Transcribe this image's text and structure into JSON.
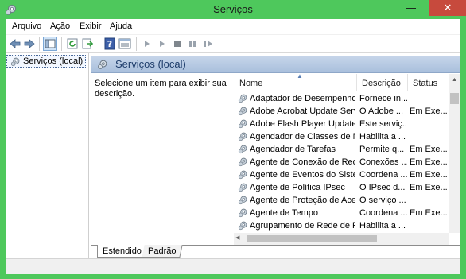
{
  "window": {
    "title": "Serviços",
    "close_glyph": "✕",
    "min_glyph": "—",
    "max_glyph": "☐"
  },
  "menu": {
    "items": [
      "Arquivo",
      "Ação",
      "Exibir",
      "Ajuda"
    ]
  },
  "toolbar": {
    "icons": [
      "back-arrow-icon",
      "forward-arrow-icon",
      "console-tree-icon",
      "refresh-icon",
      "export-list-icon",
      "help-icon",
      "properties-pane-icon",
      "start-service-icon",
      "start-service-alt-icon",
      "stop-service-icon",
      "pause-service-icon",
      "restart-service-icon"
    ]
  },
  "tree": {
    "root_label": "Serviços (local)"
  },
  "pane": {
    "title": "Serviços (local)",
    "description": "Selecione um item para exibir sua descrição."
  },
  "list": {
    "columns": {
      "name": "Nome",
      "description": "Descrição",
      "status": "Status"
    },
    "rows": [
      {
        "name": "Adaptador de Desempenho...",
        "description": "Fornece in...",
        "status": ""
      },
      {
        "name": "Adobe Acrobat Update Serv...",
        "description": "O Adobe ...",
        "status": "Em Exe..."
      },
      {
        "name": "Adobe Flash Player Update ...",
        "description": "Este serviç...",
        "status": ""
      },
      {
        "name": "Agendador de Classes de M...",
        "description": "Habilita a ...",
        "status": ""
      },
      {
        "name": "Agendador de Tarefas",
        "description": "Permite q...",
        "status": "Em Exe..."
      },
      {
        "name": "Agente de Conexão de Rede",
        "description": "Conexões ...",
        "status": "Em Exe..."
      },
      {
        "name": "Agente de Eventos do Siste...",
        "description": "Coordena ...",
        "status": "Em Exe..."
      },
      {
        "name": "Agente de Política IPsec",
        "description": "O IPsec d...",
        "status": "Em Exe..."
      },
      {
        "name": "Agente de Proteção de Ace...",
        "description": "O serviço ...",
        "status": ""
      },
      {
        "name": "Agente de Tempo",
        "description": "Coordena ...",
        "status": "Em Exe..."
      },
      {
        "name": "Agrupamento de Rede de Par",
        "description": "Habilita a ...",
        "status": ""
      }
    ]
  },
  "tabs": [
    "Estendido",
    "Padrão"
  ],
  "colors": {
    "frame": "#4ec85c",
    "close": "#c74a3d",
    "header": "#a9bfdc"
  }
}
